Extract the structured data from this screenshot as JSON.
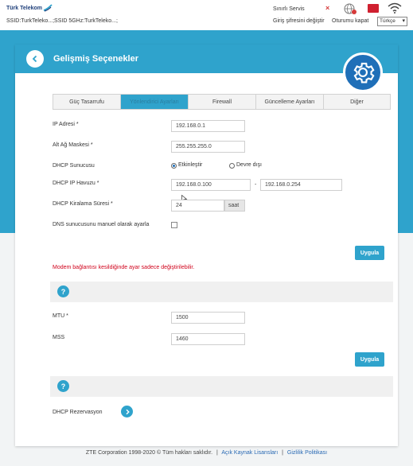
{
  "topbar": {
    "logo_text": "Türk Telekom",
    "ssid": "SSID:TurkTeleko...;SSID 5GHz:TurkTeleko...;",
    "sinirli_servis": "Sınırlı Servis",
    "giris_sifresi": "Giriş şifresini değiştir",
    "oturumu_kapat": "Oturumu kapat",
    "language": "Türkçe"
  },
  "card": {
    "title": "Gelişmiş Seçenekler",
    "tabs": [
      {
        "label": "Güç Tasarrufu"
      },
      {
        "label": "Yönlendirici Ayarları"
      },
      {
        "label": "Firewall"
      },
      {
        "label": "Güncelleme Ayarları"
      },
      {
        "label": "Diğer"
      }
    ]
  },
  "form": {
    "ip_label": "IP Adresi *",
    "ip_value": "192.168.0.1",
    "mask_label": "Alt Ağ Maskesi *",
    "mask_value": "255.255.255.0",
    "dhcp_server_label": "DHCP Sunucusu",
    "enable_label": "Etkinleştir",
    "disable_label": "Devre dışı",
    "pool_label": "DHCP IP Havuzu *",
    "pool_start": "192.168.0.100",
    "pool_sep": "-",
    "pool_end": "192.168.0.254",
    "lease_label": "DHCP Kiralama Süresi *",
    "lease_value": "24",
    "lease_unit": "saat",
    "dns_label": "DNS sunucusunu manuel olarak ayarla",
    "apply_label": "Uygula",
    "warning": "Modem bağlantısı kesildiğinde ayar sadece değiştirilebilir."
  },
  "mtu": {
    "help": "?",
    "mtu_label": "MTU *",
    "mtu_value": "1500",
    "mss_label": "MSS",
    "mss_value": "1460",
    "apply_label": "Uygula"
  },
  "dhcp_res": {
    "help": "?",
    "label": "DHCP Rezervasyon"
  },
  "footer": {
    "copyright": "ZTE Corporation 1998-2020 © Tüm hakları saklıdır.",
    "sep1": "|",
    "open_source": "Açık Kaynak Lisansları",
    "sep2": "|",
    "privacy": "Gizlilik Politikası"
  },
  "colors": {
    "accent": "#2fa3cc",
    "gear_blue": "#1f6fb8",
    "warning": "#d0021b"
  }
}
